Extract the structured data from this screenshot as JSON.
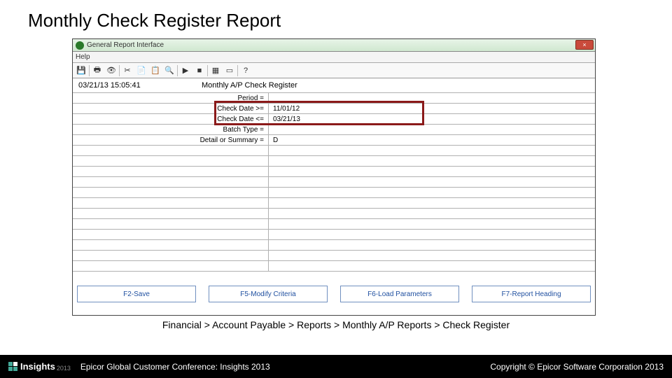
{
  "slide": {
    "title": "Monthly Check Register Report",
    "breadcrumb": "Financial > Account Payable > Reports > Monthly A/P Reports > Check Register"
  },
  "window": {
    "title": "General Report Interface",
    "close_label": "×",
    "menu": {
      "help": "Help"
    }
  },
  "toolbar": {
    "icons": [
      "save-icon",
      "divider",
      "print-icon",
      "print-preview-icon",
      "divider",
      "cut-icon",
      "copy-icon",
      "paste-icon",
      "find-icon",
      "divider",
      "run-icon",
      "stop-icon",
      "divider",
      "grid-icon",
      "form-icon",
      "divider",
      "help-icon"
    ]
  },
  "report": {
    "timestamp": "03/21/13 15:05:41",
    "title": "Monthly A/P Check Register"
  },
  "criteria": [
    {
      "label": "Period =",
      "value": ""
    },
    {
      "label": "Check Date >=",
      "value": "11/01/12"
    },
    {
      "label": "Check Date <=",
      "value": "03/21/13"
    },
    {
      "label": "Batch Type =",
      "value": ""
    },
    {
      "label": "Detail or Summary =",
      "value": "D"
    },
    {
      "label": "",
      "value": ""
    },
    {
      "label": "",
      "value": ""
    },
    {
      "label": "",
      "value": ""
    },
    {
      "label": "",
      "value": ""
    },
    {
      "label": "",
      "value": ""
    },
    {
      "label": "",
      "value": ""
    },
    {
      "label": "",
      "value": ""
    },
    {
      "label": "",
      "value": ""
    },
    {
      "label": "",
      "value": ""
    },
    {
      "label": "",
      "value": ""
    },
    {
      "label": "",
      "value": ""
    },
    {
      "label": "",
      "value": ""
    }
  ],
  "fkeys": {
    "f2": "F2-Save",
    "f5": "F5-Modify Criteria",
    "f6": "F6-Load Parameters",
    "f7": "F7-Report Heading"
  },
  "footer": {
    "brand": "Insights",
    "year": "2013",
    "conference": "Epicor Global Customer Conference: Insights 2013",
    "copyright": "Copyright © Epicor Software Corporation 2013"
  }
}
